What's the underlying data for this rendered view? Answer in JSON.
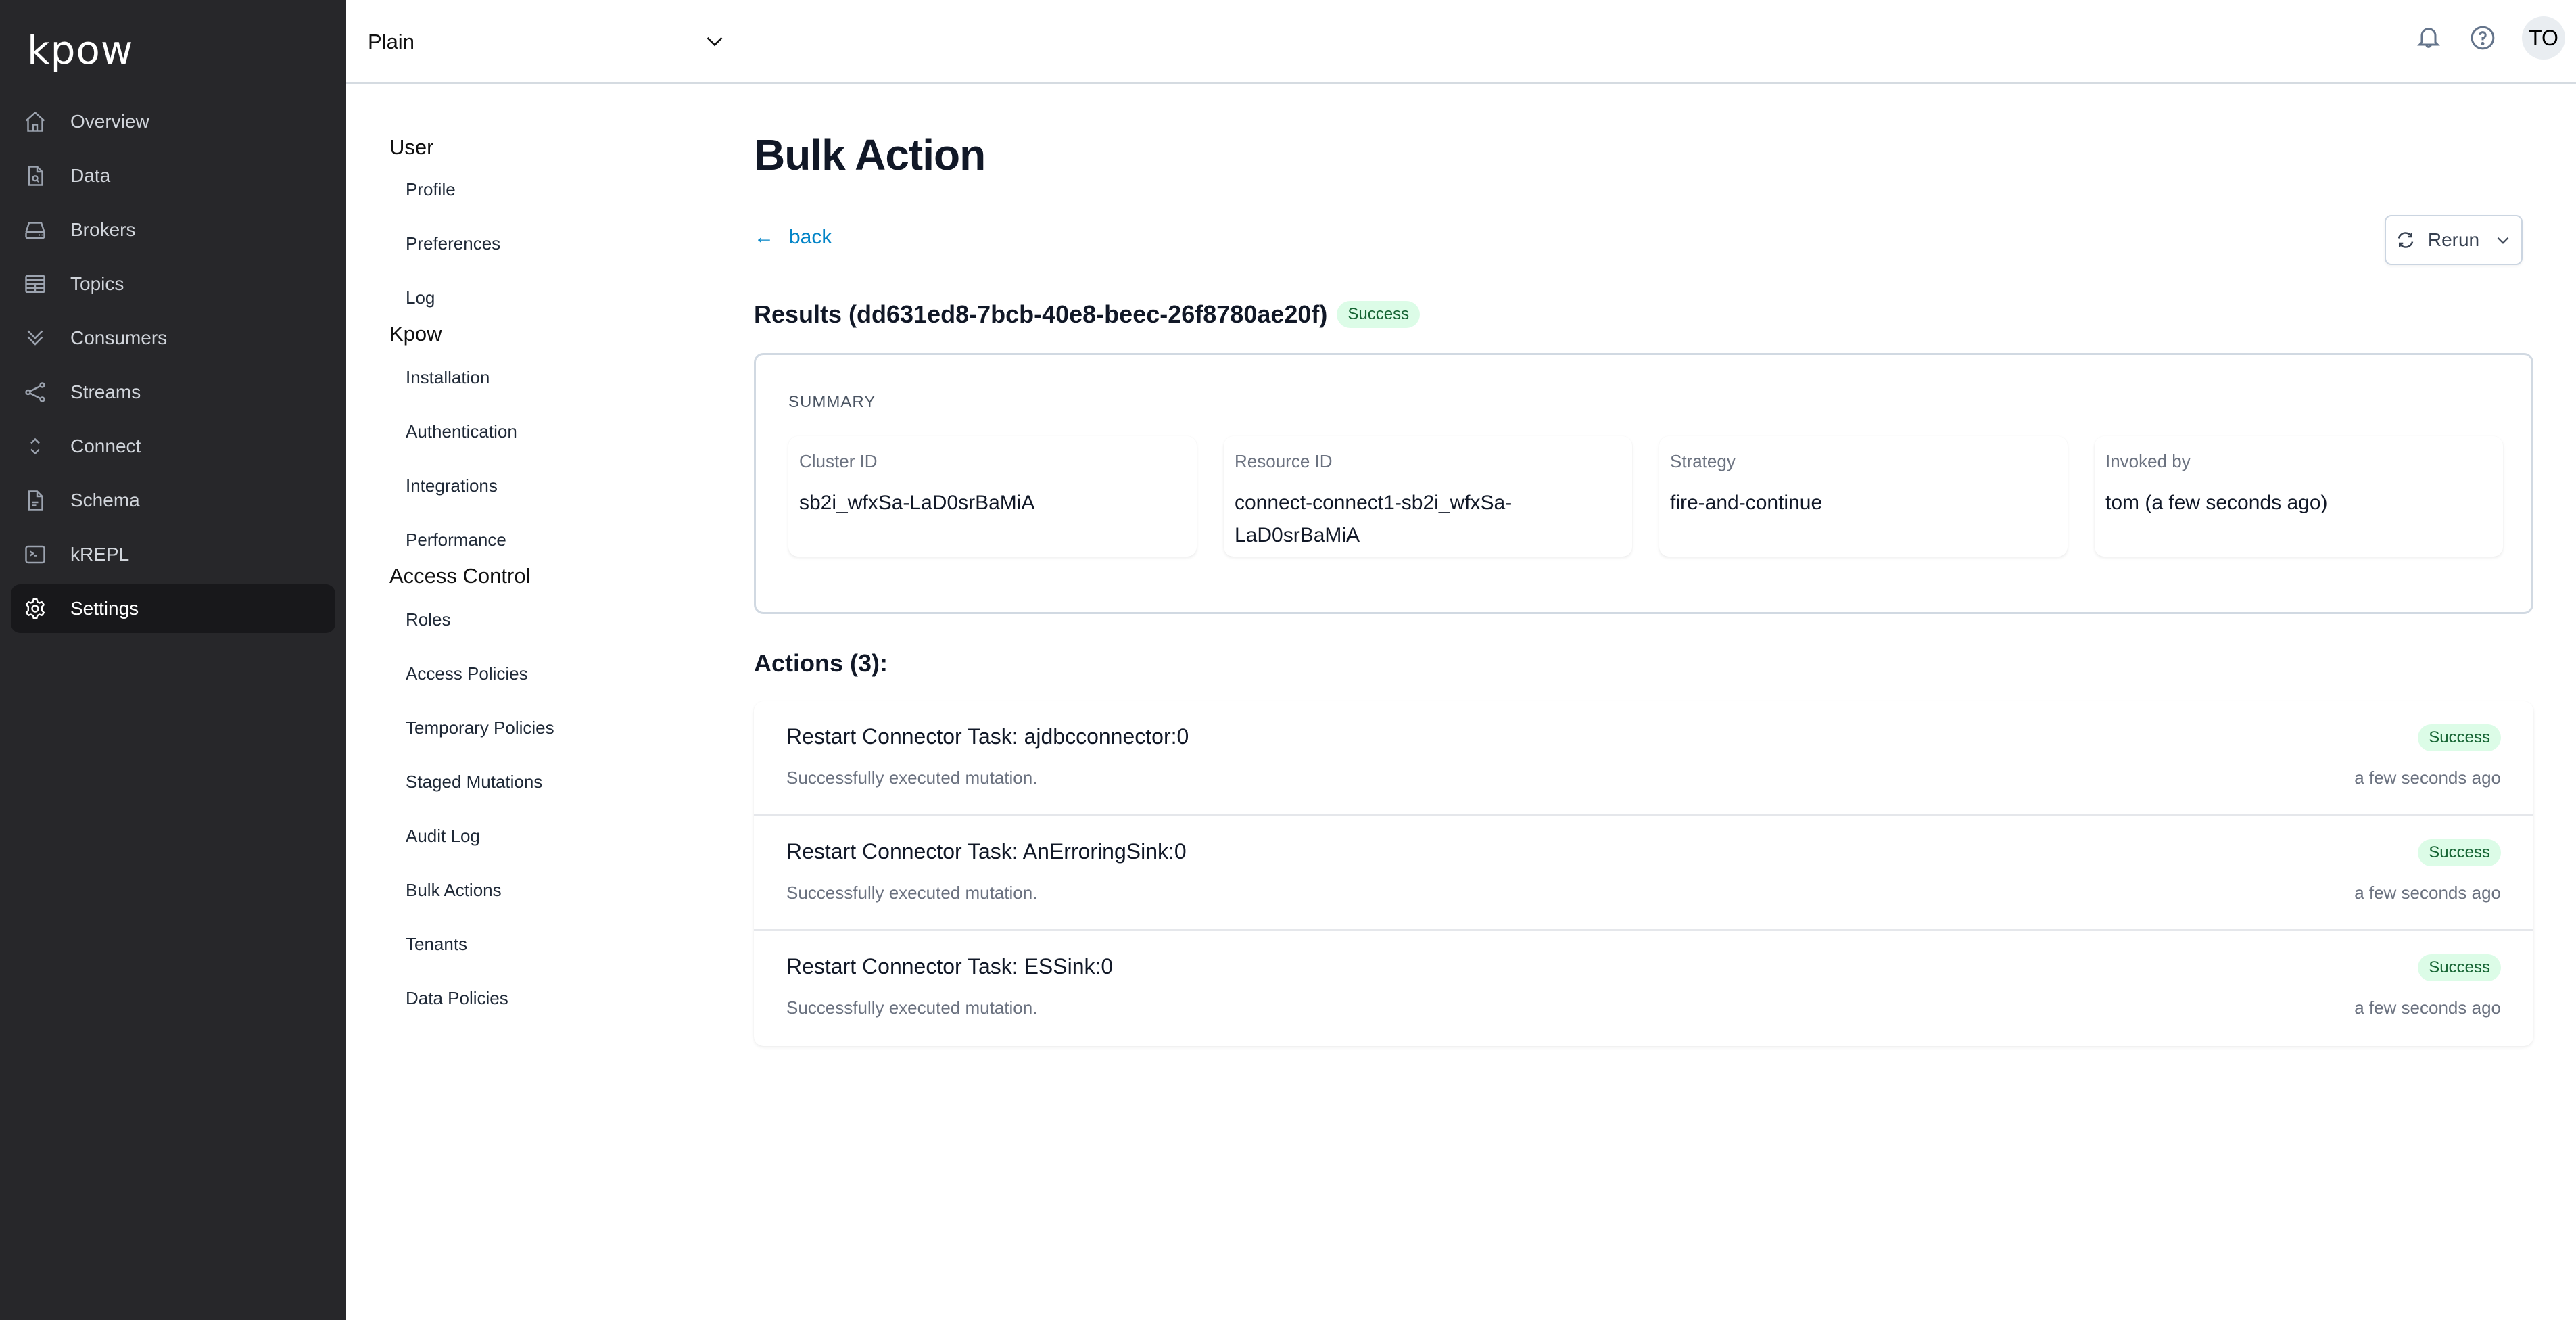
{
  "app": {
    "logo": "kpow"
  },
  "sidebar": {
    "items": [
      {
        "label": "Overview",
        "icon": "home-icon",
        "active": false
      },
      {
        "label": "Data",
        "icon": "file-search-icon",
        "active": false
      },
      {
        "label": "Brokers",
        "icon": "server-icon",
        "active": false
      },
      {
        "label": "Topics",
        "icon": "table-icon",
        "active": false
      },
      {
        "label": "Consumers",
        "icon": "chevrons-down-icon",
        "active": false
      },
      {
        "label": "Streams",
        "icon": "share-icon",
        "active": false
      },
      {
        "label": "Connect",
        "icon": "chevrons-up-down-icon",
        "active": false
      },
      {
        "label": "Schema",
        "icon": "file-text-icon",
        "active": false
      },
      {
        "label": "kREPL",
        "icon": "terminal-icon",
        "active": false
      },
      {
        "label": "Settings",
        "icon": "gear-icon",
        "active": true
      }
    ]
  },
  "topbar": {
    "tenant_selected": "Plain",
    "icons": [
      "bell-icon",
      "help-circle-icon"
    ],
    "avatar_initials": "TO"
  },
  "settings_nav": {
    "groups": [
      {
        "heading": "User",
        "items": [
          "Profile",
          "Preferences",
          "Log"
        ]
      },
      {
        "heading": "Kpow",
        "items": [
          "Installation",
          "Authentication",
          "Integrations",
          "Performance"
        ]
      },
      {
        "heading": "Access Control",
        "items": [
          "Roles",
          "Access Policies",
          "Temporary Policies",
          "Staged Mutations",
          "Audit Log",
          "Bulk Actions",
          "Tenants",
          "Data Policies"
        ]
      }
    ]
  },
  "main": {
    "title": "Bulk Action",
    "back_label": "back",
    "back_arrow": "←",
    "rerun_label": "Rerun",
    "results_heading": "Results (dd631ed8-7bcb-40e8-beec-26f8780ae20f)",
    "results_status": "Success",
    "summary": {
      "label": "SUMMARY",
      "cards": [
        {
          "key": "Cluster ID",
          "value": "sb2i_wfxSa-LaD0srBaMiA"
        },
        {
          "key": "Resource ID",
          "value": "connect-connect1-sb2i_wfxSa-LaD0srBaMiA"
        },
        {
          "key": "Strategy",
          "value": "fire-and-continue"
        },
        {
          "key": "Invoked by",
          "value": "tom (a few seconds ago)"
        }
      ]
    },
    "actions_heading": "Actions (3):",
    "actions": [
      {
        "title": "Restart Connector Task: ajdbcconnector:0",
        "description": "Successfully executed mutation.",
        "status": "Success",
        "time": "a few seconds ago"
      },
      {
        "title": "Restart Connector Task: AnErroringSink:0",
        "description": "Successfully executed mutation.",
        "status": "Success",
        "time": "a few seconds ago"
      },
      {
        "title": "Restart Connector Task: ESSink:0",
        "description": "Successfully executed mutation.",
        "status": "Success",
        "time": "a few seconds ago"
      }
    ]
  },
  "colors": {
    "sidebar_bg": "#27272a",
    "sidebar_active_bg": "#18181b",
    "link": "#0284c7",
    "success_bg": "#dcfce7",
    "success_text": "#166534"
  }
}
